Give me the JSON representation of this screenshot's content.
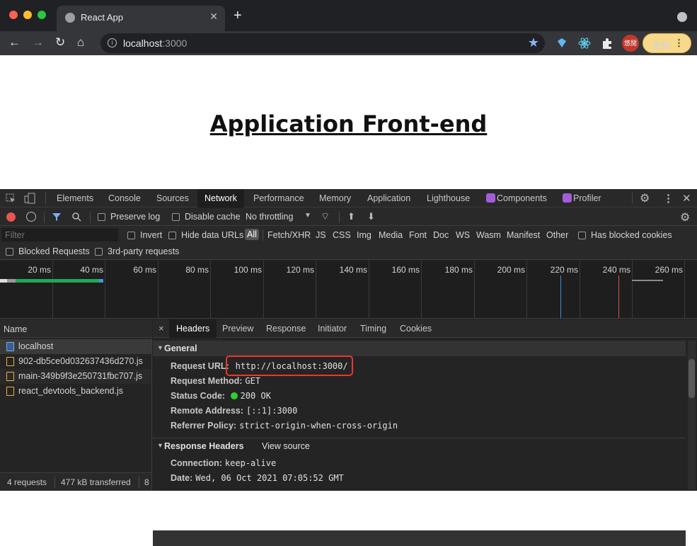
{
  "browser": {
    "tab_title": "React App",
    "new_tab": "+",
    "url_host": "localhost",
    "url_port": ":3000",
    "avatar_text": "悠閒",
    "update_label": "更新"
  },
  "page": {
    "heading": "Application Front-end"
  },
  "devtools": {
    "tabs": [
      "Elements",
      "Console",
      "Sources",
      "Network",
      "Performance",
      "Memory",
      "Application",
      "Lighthouse",
      "Components",
      "Profiler"
    ],
    "active_tab": "Network",
    "toolbar": {
      "preserve_log": "Preserve log",
      "disable_cache": "Disable cache",
      "throttling": "No throttling"
    },
    "filter": {
      "placeholder": "Filter",
      "invert": "Invert",
      "hide_data_urls": "Hide data URLs",
      "types": [
        "All",
        "Fetch/XHR",
        "JS",
        "CSS",
        "Img",
        "Media",
        "Font",
        "Doc",
        "WS",
        "Wasm",
        "Manifest",
        "Other"
      ],
      "selected_type": "All",
      "has_blocked_cookies": "Has blocked cookies",
      "blocked_requests": "Blocked Requests",
      "third_party": "3rd-party requests"
    },
    "overview_ticks": [
      "20 ms",
      "40 ms",
      "60 ms",
      "80 ms",
      "100 ms",
      "120 ms",
      "140 ms",
      "160 ms",
      "180 ms",
      "200 ms",
      "220 ms",
      "240 ms",
      "260 ms"
    ],
    "requests": {
      "header": "Name",
      "items": [
        "localhost",
        "902-db5ce0d032637436d270.js",
        "main-349b9f3e250731fbc707.js",
        "react_devtools_backend.js"
      ]
    },
    "status": {
      "requests": "4 requests",
      "transferred": "477 kB transferred",
      "more": "8"
    },
    "detail_tabs": [
      "Headers",
      "Preview",
      "Response",
      "Initiator",
      "Timing",
      "Cookies"
    ],
    "active_detail_tab": "Headers",
    "close_glyph": "×",
    "general": {
      "title": "General",
      "rows": [
        {
          "k": "Request URL:",
          "v": "http://localhost:3000/"
        },
        {
          "k": "Request Method:",
          "v": "GET"
        },
        {
          "k": "Status Code:",
          "v": "200 OK"
        },
        {
          "k": "Remote Address:",
          "v": "[::1]:3000"
        },
        {
          "k": "Referrer Policy:",
          "v": "strict-origin-when-cross-origin"
        }
      ]
    },
    "response_headers": {
      "title": "Response Headers",
      "view_source": "View source",
      "rows": [
        {
          "k": "Connection:",
          "v": "keep-alive"
        },
        {
          "k": "Date:",
          "v": "Wed, 06 Oct 2021 07:05:52 GMT"
        }
      ]
    }
  },
  "colors": {
    "highlight": "#e8382b",
    "status_ok": "#33cc33",
    "record": "#e85650"
  }
}
